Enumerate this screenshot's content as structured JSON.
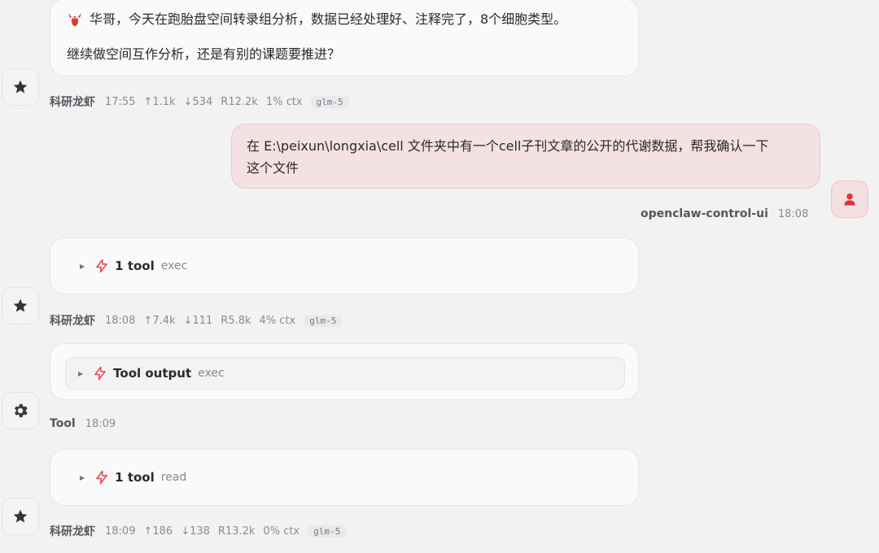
{
  "messages": [
    {
      "id": "m1",
      "role": "assistant",
      "lines": [
        "华哥，今天在跑胎盘空间转录组分析，数据已经处理好、注释完了，8个细胞类型。",
        "继续做空间互作分析，还是有别的课题要推进？"
      ],
      "lead_icon": "lobster-icon",
      "avatar_icon": "star-icon",
      "meta": {
        "sender": "科研龙虾",
        "time": "17:55",
        "up": "↑1.1k",
        "down": "↓534",
        "r": "R12.2k",
        "ctx": "1% ctx",
        "model": "glm-5"
      }
    },
    {
      "id": "m2",
      "role": "user",
      "lines": [
        "在 E:\\peixun\\longxia\\cell 文件夹中有一个cell子刊文章的公开的代谢数据，帮我确认一下",
        "这个文件"
      ],
      "avatar_icon": "user-icon",
      "meta": {
        "sender": "openclaw-control-ui",
        "time": "18:08"
      }
    },
    {
      "id": "m3",
      "role": "assistant",
      "tool": {
        "label": "1 tool",
        "kind": "exec"
      },
      "avatar_icon": "star-icon",
      "meta": {
        "sender": "科研龙虾",
        "time": "18:08",
        "up": "↑7.4k",
        "down": "↓111",
        "r": "R5.8k",
        "ctx": "4% ctx",
        "model": "glm-5"
      }
    },
    {
      "id": "m4",
      "role": "tool",
      "tool": {
        "label": "Tool output",
        "kind": "exec"
      },
      "avatar_icon": "gear-icon",
      "meta": {
        "sender": "Tool",
        "time": "18:09"
      }
    },
    {
      "id": "m5",
      "role": "assistant",
      "tool": {
        "label": "1 tool",
        "kind": "read"
      },
      "avatar_icon": "star-icon",
      "meta": {
        "sender": "科研龙虾",
        "time": "18:09",
        "up": "↑186",
        "down": "↓138",
        "r": "R13.2k",
        "ctx": "0% ctx",
        "model": "glm-5"
      }
    }
  ],
  "colors": {
    "accent_red": "#e0484c",
    "user_bubble": "#f3e1e3",
    "assistant_bubble": "#fafafb",
    "background": "#f2f2f3"
  }
}
